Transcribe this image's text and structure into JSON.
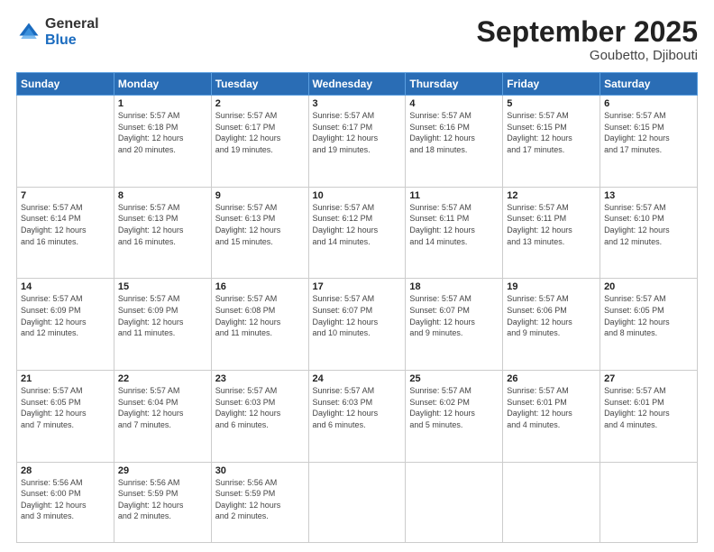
{
  "header": {
    "logo_general": "General",
    "logo_blue": "Blue",
    "title": "September 2025",
    "location": "Goubetto, Djibouti"
  },
  "weekdays": [
    "Sunday",
    "Monday",
    "Tuesday",
    "Wednesday",
    "Thursday",
    "Friday",
    "Saturday"
  ],
  "weeks": [
    [
      {
        "day": "",
        "info": ""
      },
      {
        "day": "1",
        "info": "Sunrise: 5:57 AM\nSunset: 6:18 PM\nDaylight: 12 hours\nand 20 minutes."
      },
      {
        "day": "2",
        "info": "Sunrise: 5:57 AM\nSunset: 6:17 PM\nDaylight: 12 hours\nand 19 minutes."
      },
      {
        "day": "3",
        "info": "Sunrise: 5:57 AM\nSunset: 6:17 PM\nDaylight: 12 hours\nand 19 minutes."
      },
      {
        "day": "4",
        "info": "Sunrise: 5:57 AM\nSunset: 6:16 PM\nDaylight: 12 hours\nand 18 minutes."
      },
      {
        "day": "5",
        "info": "Sunrise: 5:57 AM\nSunset: 6:15 PM\nDaylight: 12 hours\nand 17 minutes."
      },
      {
        "day": "6",
        "info": "Sunrise: 5:57 AM\nSunset: 6:15 PM\nDaylight: 12 hours\nand 17 minutes."
      }
    ],
    [
      {
        "day": "7",
        "info": "Sunrise: 5:57 AM\nSunset: 6:14 PM\nDaylight: 12 hours\nand 16 minutes."
      },
      {
        "day": "8",
        "info": "Sunrise: 5:57 AM\nSunset: 6:13 PM\nDaylight: 12 hours\nand 16 minutes."
      },
      {
        "day": "9",
        "info": "Sunrise: 5:57 AM\nSunset: 6:13 PM\nDaylight: 12 hours\nand 15 minutes."
      },
      {
        "day": "10",
        "info": "Sunrise: 5:57 AM\nSunset: 6:12 PM\nDaylight: 12 hours\nand 14 minutes."
      },
      {
        "day": "11",
        "info": "Sunrise: 5:57 AM\nSunset: 6:11 PM\nDaylight: 12 hours\nand 14 minutes."
      },
      {
        "day": "12",
        "info": "Sunrise: 5:57 AM\nSunset: 6:11 PM\nDaylight: 12 hours\nand 13 minutes."
      },
      {
        "day": "13",
        "info": "Sunrise: 5:57 AM\nSunset: 6:10 PM\nDaylight: 12 hours\nand 12 minutes."
      }
    ],
    [
      {
        "day": "14",
        "info": "Sunrise: 5:57 AM\nSunset: 6:09 PM\nDaylight: 12 hours\nand 12 minutes."
      },
      {
        "day": "15",
        "info": "Sunrise: 5:57 AM\nSunset: 6:09 PM\nDaylight: 12 hours\nand 11 minutes."
      },
      {
        "day": "16",
        "info": "Sunrise: 5:57 AM\nSunset: 6:08 PM\nDaylight: 12 hours\nand 11 minutes."
      },
      {
        "day": "17",
        "info": "Sunrise: 5:57 AM\nSunset: 6:07 PM\nDaylight: 12 hours\nand 10 minutes."
      },
      {
        "day": "18",
        "info": "Sunrise: 5:57 AM\nSunset: 6:07 PM\nDaylight: 12 hours\nand 9 minutes."
      },
      {
        "day": "19",
        "info": "Sunrise: 5:57 AM\nSunset: 6:06 PM\nDaylight: 12 hours\nand 9 minutes."
      },
      {
        "day": "20",
        "info": "Sunrise: 5:57 AM\nSunset: 6:05 PM\nDaylight: 12 hours\nand 8 minutes."
      }
    ],
    [
      {
        "day": "21",
        "info": "Sunrise: 5:57 AM\nSunset: 6:05 PM\nDaylight: 12 hours\nand 7 minutes."
      },
      {
        "day": "22",
        "info": "Sunrise: 5:57 AM\nSunset: 6:04 PM\nDaylight: 12 hours\nand 7 minutes."
      },
      {
        "day": "23",
        "info": "Sunrise: 5:57 AM\nSunset: 6:03 PM\nDaylight: 12 hours\nand 6 minutes."
      },
      {
        "day": "24",
        "info": "Sunrise: 5:57 AM\nSunset: 6:03 PM\nDaylight: 12 hours\nand 6 minutes."
      },
      {
        "day": "25",
        "info": "Sunrise: 5:57 AM\nSunset: 6:02 PM\nDaylight: 12 hours\nand 5 minutes."
      },
      {
        "day": "26",
        "info": "Sunrise: 5:57 AM\nSunset: 6:01 PM\nDaylight: 12 hours\nand 4 minutes."
      },
      {
        "day": "27",
        "info": "Sunrise: 5:57 AM\nSunset: 6:01 PM\nDaylight: 12 hours\nand 4 minutes."
      }
    ],
    [
      {
        "day": "28",
        "info": "Sunrise: 5:56 AM\nSunset: 6:00 PM\nDaylight: 12 hours\nand 3 minutes."
      },
      {
        "day": "29",
        "info": "Sunrise: 5:56 AM\nSunset: 5:59 PM\nDaylight: 12 hours\nand 2 minutes."
      },
      {
        "day": "30",
        "info": "Sunrise: 5:56 AM\nSunset: 5:59 PM\nDaylight: 12 hours\nand 2 minutes."
      },
      {
        "day": "",
        "info": ""
      },
      {
        "day": "",
        "info": ""
      },
      {
        "day": "",
        "info": ""
      },
      {
        "day": "",
        "info": ""
      }
    ]
  ]
}
